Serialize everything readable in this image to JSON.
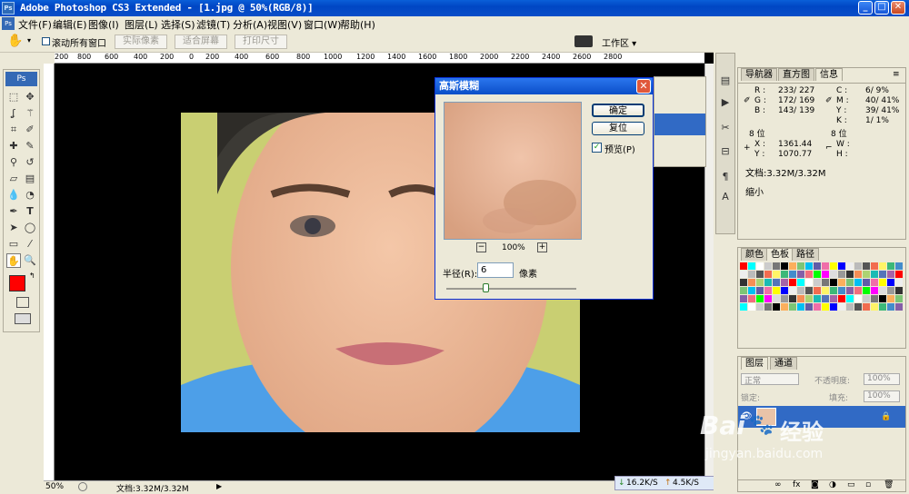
{
  "window": {
    "title": "Adobe Photoshop CS3 Extended - [1.jpg @ 50%(RGB/8)]",
    "min": "_",
    "max": "□",
    "close": "✕"
  },
  "menu": [
    "文件(F)",
    "编辑(E)",
    "图像(I)",
    "图层(L)",
    "选择(S)",
    "滤镜(T)",
    "分析(A)",
    "视图(V)",
    "窗口(W)",
    "帮助(H)"
  ],
  "options": {
    "scroll_all": "滚动所有窗口",
    "actual_pixels": "实际像素",
    "fit_screen": "适合屏幕",
    "print_size": "打印尺寸",
    "workspace": "工作区"
  },
  "ruler_labels": [
    "200",
    "800",
    "600",
    "400",
    "200",
    "0",
    "200",
    "400",
    "600",
    "800",
    "1000",
    "1200",
    "1400",
    "1600",
    "1800",
    "2000",
    "2200",
    "2400",
    "2600",
    "2800"
  ],
  "dialog": {
    "title": "高斯模糊",
    "ok": "确定",
    "reset": "复位",
    "preview": "预览(P)",
    "zoom": "100%",
    "zoom_out": "−",
    "zoom_in": "+",
    "radius_label": "半径(R):",
    "radius_value": "6",
    "unit": "像素"
  },
  "info_panel": {
    "tabs": [
      "导航器",
      "直方图",
      "信息"
    ],
    "r": "R :",
    "r_val": "233/ 227",
    "g": "G :",
    "g_val": "172/ 169",
    "b": "B :",
    "b_val": "143/ 139",
    "c": "C :",
    "c_val": "6/ 9%",
    "m": "M :",
    "m_val": "40/ 41%",
    "y": "Y :",
    "y_val": "39/ 41%",
    "k": "K :",
    "k_val": "1/ 1%",
    "bit1": "8 位",
    "bit2": "8 位",
    "x": "X :",
    "x_val": "1361.44",
    "yy": "Y :",
    "yy_val": "1070.77",
    "w": "W :",
    "h": "H :",
    "doc": "文档:3.32M/3.32M",
    "hint": "缩小"
  },
  "swatch_panel": {
    "tabs": [
      "颜色",
      "色板",
      "路径"
    ]
  },
  "layers_panel": {
    "tabs": [
      "图层",
      "通道"
    ],
    "blend": "正常",
    "opacity_label": "不透明度:",
    "opacity": "100%",
    "lock": "锁定:",
    "fill_label": "填充:",
    "fill": "100%"
  },
  "status": {
    "zoom": "50%",
    "doc": "文档:3.32M/3.32M",
    "down": "16.2K/S",
    "up": "4.5K/S"
  },
  "watermark": {
    "brand": "Bai",
    "brand2": "经验",
    "url": "jingyan.baidu.com"
  },
  "colors": {
    "foreground": "#ff0000",
    "background": "#ffffff",
    "titlebar": "#0a4ec8",
    "accent": "#316ac5"
  }
}
